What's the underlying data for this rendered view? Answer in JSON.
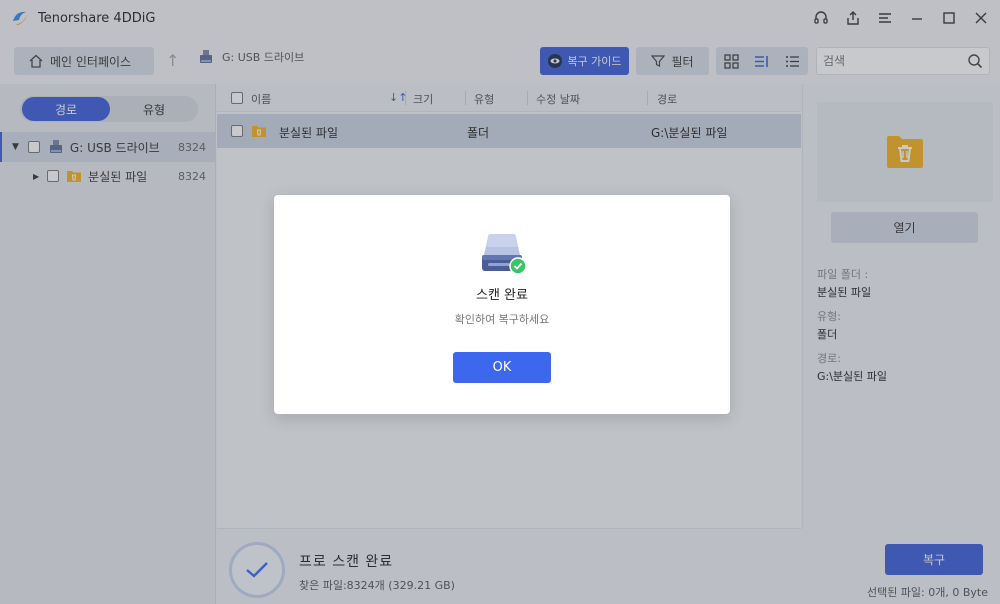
{
  "app": {
    "title": "Tenorshare 4DDiG"
  },
  "toolbar": {
    "home_label": "메인 인터페이스",
    "breadcrumb": "G: USB 드라이브",
    "guide_label": "복구 가이드",
    "filter_label": "필터",
    "search_placeholder": "검색"
  },
  "sidebar": {
    "tabs": {
      "path": "경로",
      "type": "유형"
    },
    "tree": [
      {
        "label": "G: USB 드라이브",
        "count": "8324"
      },
      {
        "label": "분실된 파일",
        "count": "8324"
      }
    ]
  },
  "list": {
    "columns": {
      "name": "이름",
      "size": "크기",
      "type": "유형",
      "modified": "수정 날짜",
      "path": "경로"
    },
    "rows": [
      {
        "name": "분실된 파일",
        "size": "",
        "type": "폴더",
        "modified": "",
        "path": "G:\\분실된 파일"
      }
    ]
  },
  "details": {
    "open_label": "열기",
    "folder_label": "파일 폴더 :",
    "folder_value": "분실된 파일",
    "type_label": "유형:",
    "type_value": "폴더",
    "path_label": "경로:",
    "path_value": "G:\\분실된 파일"
  },
  "status": {
    "title": "프로 스캔 완료",
    "found": "찾은 파일:8324개 (329.21 GB)",
    "recover_label": "복구",
    "selected": "선택된 파일: 0개, 0 Byte"
  },
  "modal": {
    "title": "스캔 완료",
    "message": "확인하여 복구하세요",
    "ok_label": "OK"
  },
  "colors": {
    "accent": "#3d5ed8",
    "folder": "#f5b21e",
    "success": "#3cc46a"
  }
}
